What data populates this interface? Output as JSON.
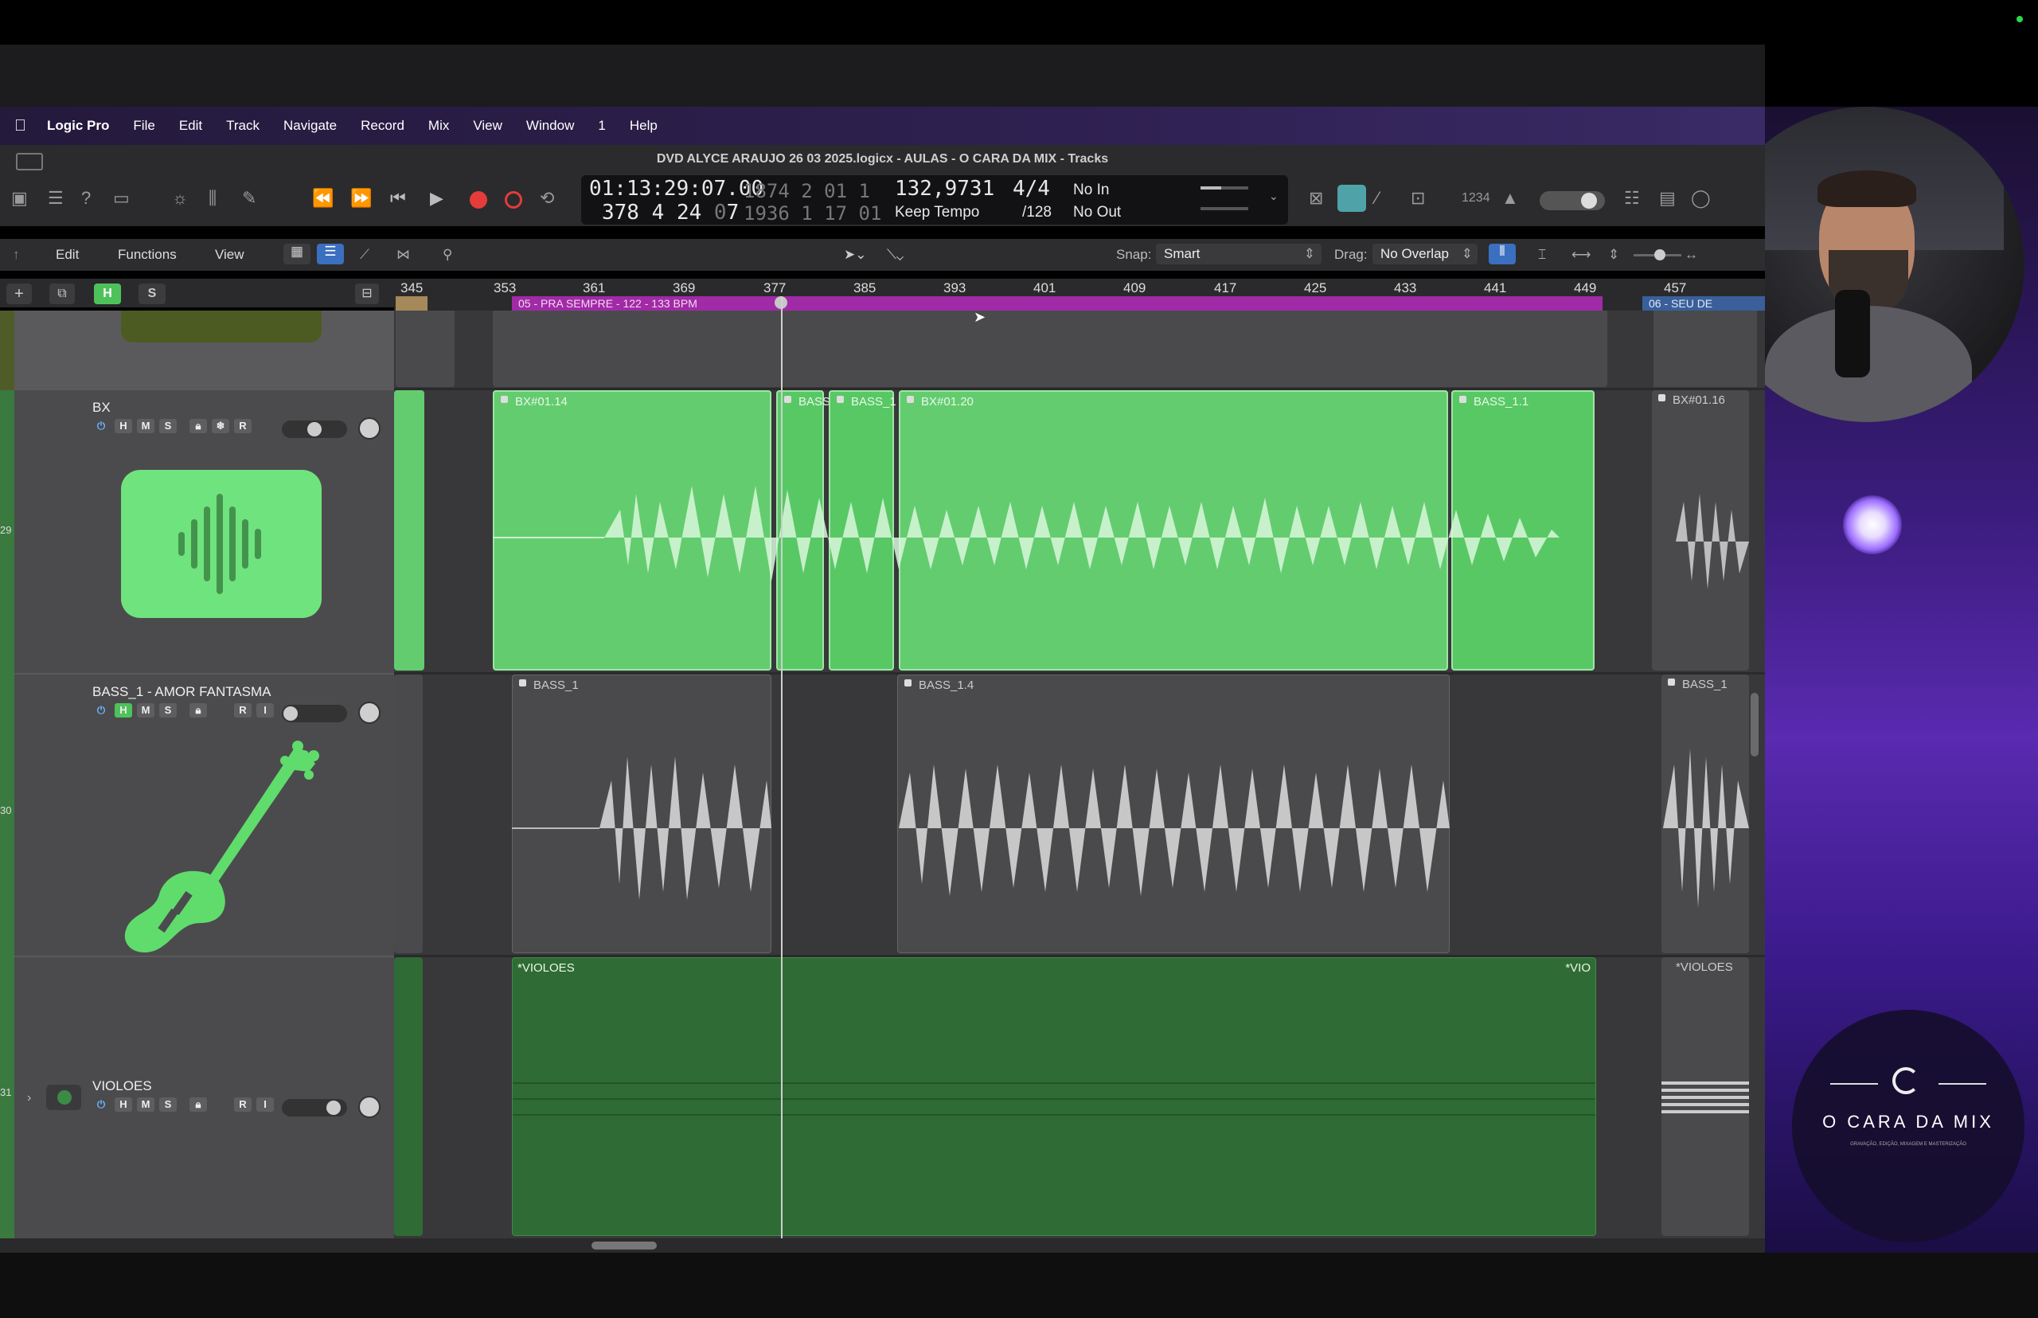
{
  "menubar": {
    "items": [
      "Logic Pro",
      "File",
      "Edit",
      "Track",
      "Navigate",
      "Record",
      "Mix",
      "View",
      "Window",
      "1",
      "Help"
    ]
  },
  "window": {
    "title": "DVD ALYCE ARAUJO 26 03 2025.logicx - AULAS - O CARA DA MIX - Tracks"
  },
  "lcd": {
    "smpte": "01:13:29:07.00",
    "bars_top": [
      "1874",
      "2",
      "01",
      "1"
    ],
    "bars_bottom": [
      "378",
      "4",
      "24",
      "7"
    ],
    "sub_top": [
      "1874",
      "2",
      "01",
      "1"
    ],
    "pos2_top": "1874 2",
    "pos2_a": "01",
    "pos2_b": "1",
    "pos2_bottom": "1936 1",
    "pos2_c": "17",
    "pos2_d": "01",
    "tempo": "132,9731",
    "tempo_mode": "Keep Tempo",
    "signature": "4/4",
    "division": "/128",
    "in": "No In",
    "out": "No Out"
  },
  "editbar": {
    "edit": "Edit",
    "functions": "Functions",
    "view": "View",
    "snap_label": "Snap:",
    "snap_value": "Smart",
    "drag_label": "Drag:",
    "drag_value": "No Overlap"
  },
  "track_header_buttons": {
    "h": "H",
    "s": "S"
  },
  "ruler": [
    "345",
    "353",
    "361",
    "369",
    "377",
    "385",
    "393",
    "401",
    "409",
    "417",
    "425",
    "433",
    "441",
    "449",
    "457"
  ],
  "markers": {
    "main": "05 - PRA SEMPRE - 122 - 133 BPM",
    "next": "06 - SEU DE"
  },
  "tracks": [
    {
      "name": "BX",
      "buttons": [
        "H",
        "M",
        "S",
        "R"
      ],
      "regions": [
        "BX#01.14",
        "BASS",
        "BASS_1",
        "BX#01.20",
        "BASS_1.1",
        "BX#01.16"
      ]
    },
    {
      "name": "BASS_1 - AMOR FANTASMA",
      "buttons": [
        "H",
        "M",
        "S",
        "R",
        "I"
      ],
      "regions": [
        "BASS_1",
        "BASS_1.4",
        "BASS_1"
      ]
    },
    {
      "name": "VIOLOES",
      "buttons": [
        "H",
        "M",
        "S",
        "R",
        "I"
      ],
      "regions": [
        "*VIOLOES",
        "*VIO",
        "*VIOLOES"
      ]
    }
  ],
  "side_numbers": [
    "29",
    "30",
    "31"
  ],
  "overlay_brand": {
    "name": "O CARA DA MIX",
    "tagline": "GRAVAÇÃO, EDIÇÃO, MIXAGEM E MASTERIZAÇÃO"
  },
  "colors": {
    "green_region": "#63cc6f",
    "gray_region": "#4a4a4c",
    "dark_green_region": "#2f6b34",
    "marker_purple": "#a12aa6",
    "menubar": "#2e2050"
  }
}
